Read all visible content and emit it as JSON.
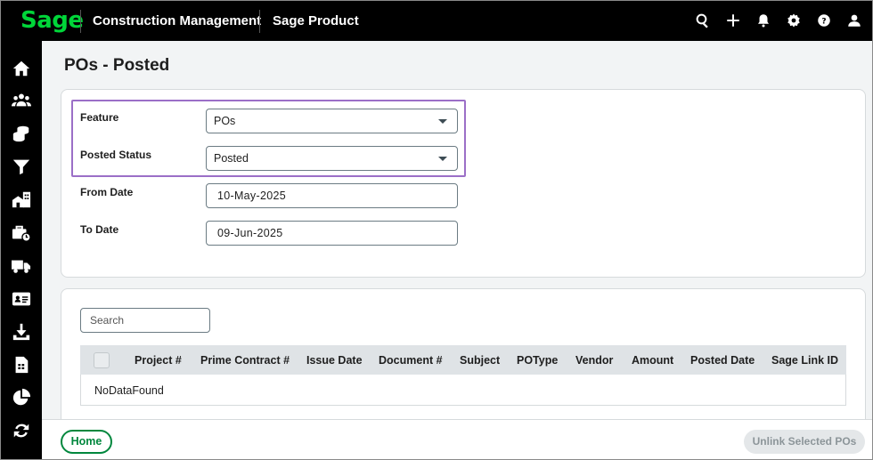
{
  "header": {
    "logo": "Sage",
    "app_name": "Construction Management",
    "product_name": "Sage Product",
    "icons": [
      "search-icon",
      "plus-icon",
      "bell-icon",
      "gear-icon",
      "help-icon",
      "user-icon"
    ]
  },
  "sidebar": {
    "items": [
      "home-icon",
      "people-icon",
      "coins-icon",
      "filter-icon",
      "buildings-icon",
      "toolbox-clock-icon",
      "truck-icon",
      "id-card-icon",
      "download-icon",
      "calculator-icon",
      "pie-chart-icon",
      "sync-icon"
    ]
  },
  "page": {
    "title": "POs - Posted"
  },
  "filters": {
    "feature_label": "Feature",
    "feature_value": "POs",
    "posted_status_label": "Posted Status",
    "posted_status_value": "Posted",
    "from_date_label": "From Date",
    "from_date_value": "10-May-2025",
    "to_date_label": "To Date",
    "to_date_value": "09-Jun-2025"
  },
  "table": {
    "search_placeholder": "Search",
    "columns": [
      "Project #",
      "Prime Contract #",
      "Issue Date",
      "Document #",
      "Subject",
      "POType",
      "Vendor",
      "Amount",
      "Posted Date",
      "Sage Link ID"
    ],
    "empty_text": "NoDataFound"
  },
  "footer": {
    "home_label": "Home",
    "unlink_label": "Unlink Selected POs"
  },
  "colors": {
    "brand_green": "#00d639",
    "button_green": "#00873d",
    "highlight_purple": "#9b6fc7"
  }
}
